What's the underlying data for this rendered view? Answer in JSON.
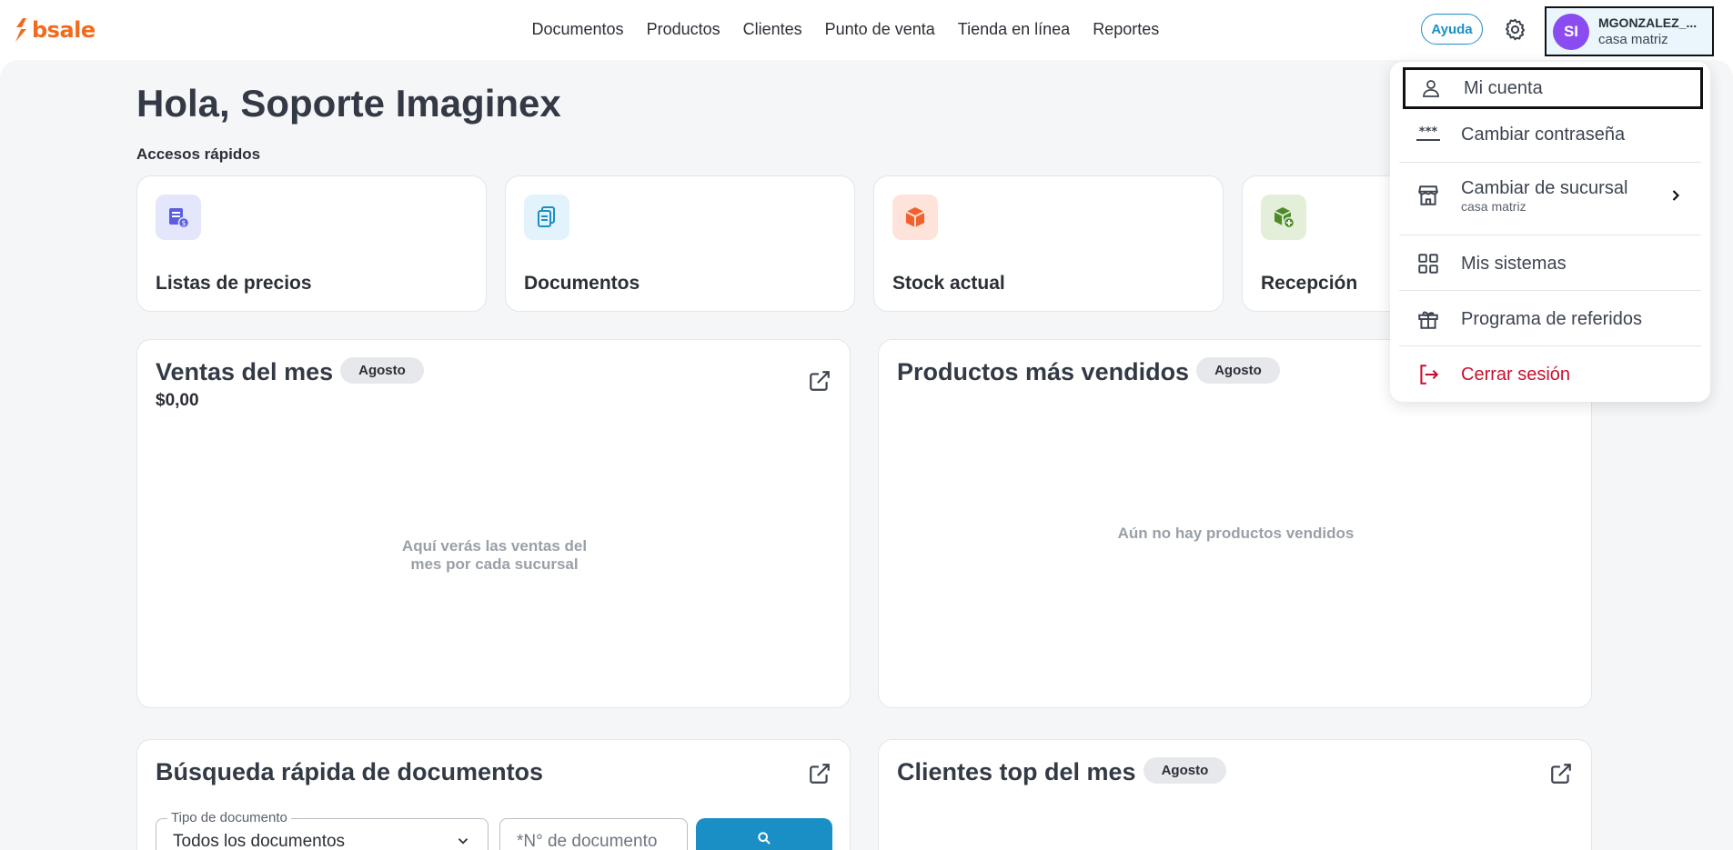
{
  "header": {
    "logo_text": "bsale",
    "nav": [
      "Documentos",
      "Productos",
      "Clientes",
      "Punto de venta",
      "Tienda en línea",
      "Reportes"
    ],
    "help_label": "Ayuda",
    "user": {
      "initials": "SI",
      "name": "MGONZALEZ_...",
      "branch": "casa matriz"
    }
  },
  "main": {
    "greeting": "Hola, Soporte Imaginex",
    "quick_access_label": "Accesos rápidos",
    "quick_access": [
      {
        "label": "Listas de precios",
        "icon": "price-list-icon",
        "bg": "#e4e6fb",
        "color": "#5b5ee0"
      },
      {
        "label": "Documentos",
        "icon": "document-icon",
        "bg": "#e3f3fb",
        "color": "#1a8fc6"
      },
      {
        "label": "Stock actual",
        "icon": "box-icon",
        "bg": "#fde3da",
        "color": "#f2612d"
      },
      {
        "label": "Recepción",
        "icon": "box-add-icon",
        "bg": "#e3efd9",
        "color": "#4e8a2a"
      }
    ],
    "sales": {
      "title": "Ventas del mes",
      "badge": "Agosto",
      "amount": "$0,00",
      "empty": [
        "Aquí verás las ventas del",
        "mes por cada sucursal"
      ]
    },
    "top_products": {
      "title": "Productos más vendidos",
      "badge": "Agosto",
      "empty": "Aún no hay productos vendidos"
    },
    "doc_search": {
      "title": "Búsqueda rápida de documentos",
      "type_legend": "Tipo de documento",
      "type_value": "Todos los documentos",
      "number_placeholder": "*N° de documento"
    },
    "top_clients": {
      "title": "Clientes top del mes",
      "badge": "Agosto"
    }
  },
  "menu": {
    "items": [
      {
        "label": "Mi cuenta",
        "icon": "user-icon"
      },
      {
        "label": "Cambiar contraseña",
        "icon": "password-icon"
      },
      {
        "label": "Cambiar de sucursal",
        "sub": "casa matriz",
        "icon": "store-icon"
      },
      {
        "label": "Mis sistemas",
        "icon": "grid-icon"
      },
      {
        "label": "Programa de referidos",
        "icon": "gift-icon"
      },
      {
        "label": "Cerrar sesión",
        "icon": "logout-icon",
        "color": "#c8102e"
      }
    ]
  },
  "colors": {
    "brand": "#f26b1d",
    "accent": "#1a8fc6",
    "avatar": "#8a4bf0",
    "danger": "#c8102e"
  }
}
